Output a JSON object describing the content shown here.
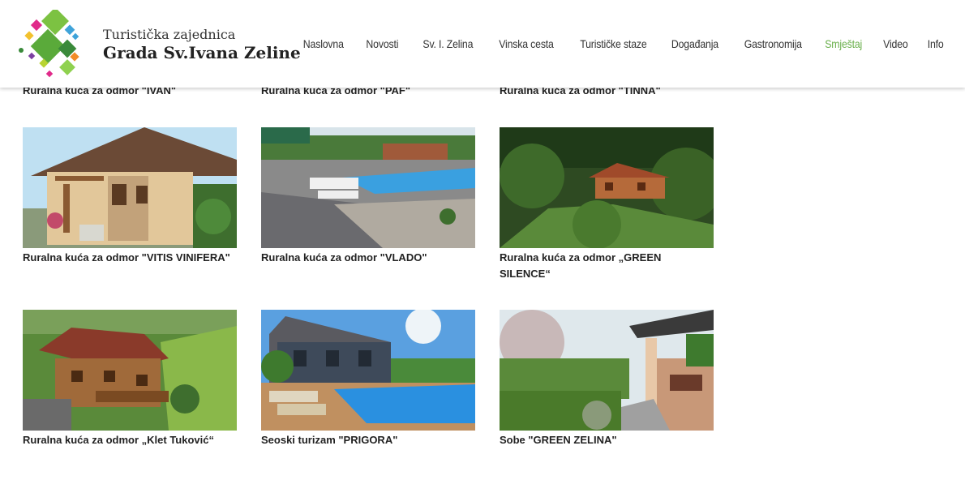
{
  "header": {
    "logo_line1": "Turistička zajednica",
    "logo_line2": "Grada Sv.Ivana Zeline",
    "nav": [
      {
        "label": "Naslovna"
      },
      {
        "label": "Novosti"
      },
      {
        "label": "Sv. I. Zelina"
      },
      {
        "label": "Vinska cesta"
      },
      {
        "label": "Turističke staze"
      },
      {
        "label": "Događanja"
      },
      {
        "label": "Gastronomija"
      },
      {
        "label": "Smještaj",
        "active": true
      },
      {
        "label": "Video"
      },
      {
        "label": "Info"
      }
    ],
    "active_color": "#6ab04c"
  },
  "top_row": [
    {
      "title": "Ruralna kuća za odmor \"IVAN\""
    },
    {
      "title": "Ruralna kuća za odmor \"PAF\""
    },
    {
      "title": "Ruralna kuća za odmor \"TINNA\""
    }
  ],
  "listings": [
    {
      "title": "Ruralna kuća za odmor \"VITIS VINIFERA\"",
      "image": "house-photo"
    },
    {
      "title": "Ruralna kuća za odmor \"VLADO\"",
      "image": "pool-photo"
    },
    {
      "title": "Ruralna kuća za odmor „GREEN SILENCE“",
      "image": "forest-house-photo"
    },
    {
      "title": "Ruralna kuća za odmor „Klet Tuković“",
      "image": "wooden-house-photo"
    },
    {
      "title": "Seoski turizam \"PRIGORA\"",
      "image": "pool-house-photo"
    },
    {
      "title": "Sobe \"GREEN ZELINA\"",
      "image": "garden-terrace-photo"
    }
  ]
}
